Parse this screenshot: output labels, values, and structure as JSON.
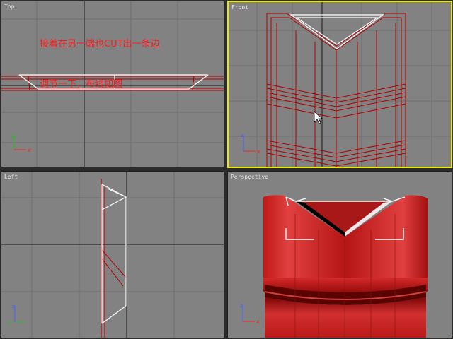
{
  "viewports": {
    "top": {
      "label": "Top"
    },
    "front": {
      "label": "Front"
    },
    "left": {
      "label": "Left"
    },
    "perspective": {
      "label": "Perspective"
    }
  },
  "annotation": {
    "line1": "接着在另一端也CUT出一条边",
    "line2": "调节一下，布线如图"
  },
  "axis_labels": {
    "x": "x",
    "y": "y",
    "z": "z"
  },
  "colors": {
    "viewport_bg": "#828282",
    "active_border": "#e8e800",
    "wire_selected": "#ffffff",
    "wire_object": "#b30000",
    "grid_line": "#6e6e6e",
    "grid_axis": "#1a1a1a",
    "note_text": "#ff1a1a"
  }
}
